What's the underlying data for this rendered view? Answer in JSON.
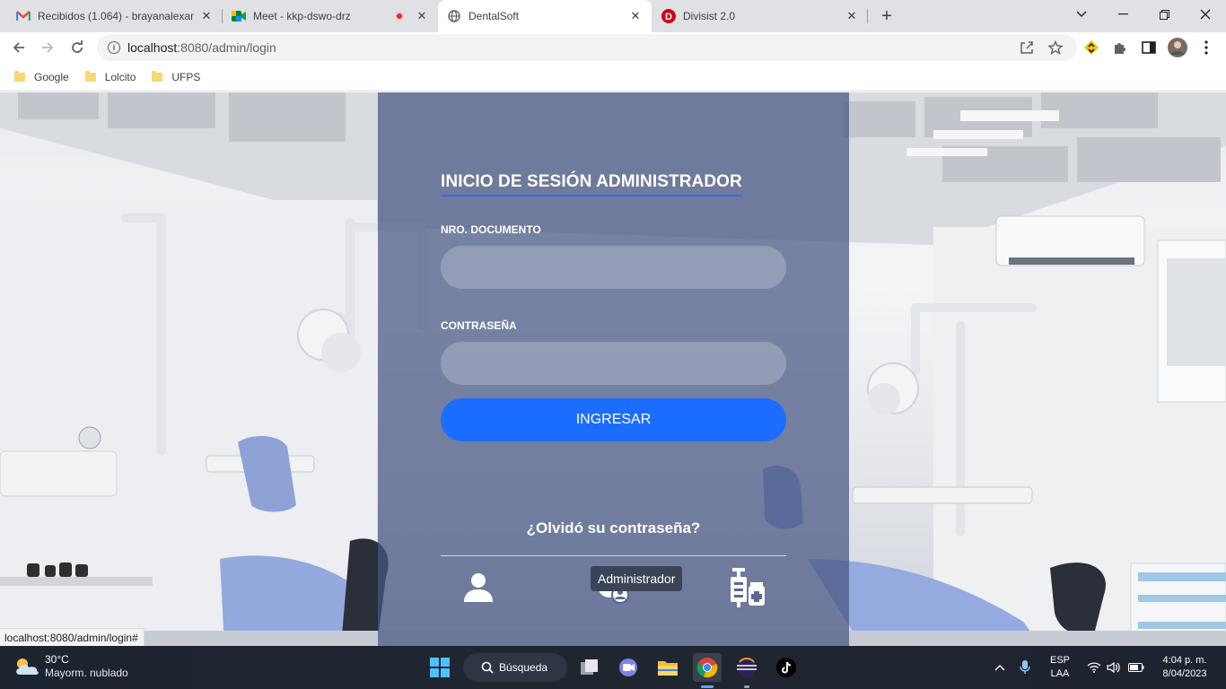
{
  "browser": {
    "tabs": [
      {
        "title": "Recibidos (1.064) - brayanalexanc",
        "icon": "gmail-icon"
      },
      {
        "title": "Meet - kkp-dswo-drz",
        "icon": "meet-icon"
      },
      {
        "title": "DentalSoft",
        "icon": "globe-icon",
        "active": true
      },
      {
        "title": "Divisist 2.0",
        "icon": "divisist-icon"
      }
    ],
    "url_host": "localhost",
    "url_path": ":8080/admin/login",
    "bookmarks": [
      "Google",
      "Lolcito",
      "UFPS"
    ]
  },
  "login": {
    "title": "INICIO DE SESIÓN ADMINISTRADOR",
    "document_label": "NRO. DOCUMENTO",
    "document_value": "",
    "password_label": "CONTRASEÑA",
    "password_value": "",
    "submit_label": "INGRESAR",
    "forgot_label": "¿Olvidó su contraseña?",
    "role_tooltip": "Administrador",
    "roles": [
      "patient-icon",
      "admin-icon",
      "medical-supplies-icon"
    ]
  },
  "status_url": "localhost:8080/admin/login#",
  "taskbar": {
    "temperature": "30°C",
    "condition": "Mayorm. nublado",
    "search_label": "Búsqueda",
    "language": "ESP",
    "layout": "LAA",
    "time": "4:04 p. m.",
    "date": "8/04/2023"
  },
  "colors": {
    "panel": "#465682",
    "accent": "#1a6dff",
    "title_underline": "#2f6fe0"
  }
}
